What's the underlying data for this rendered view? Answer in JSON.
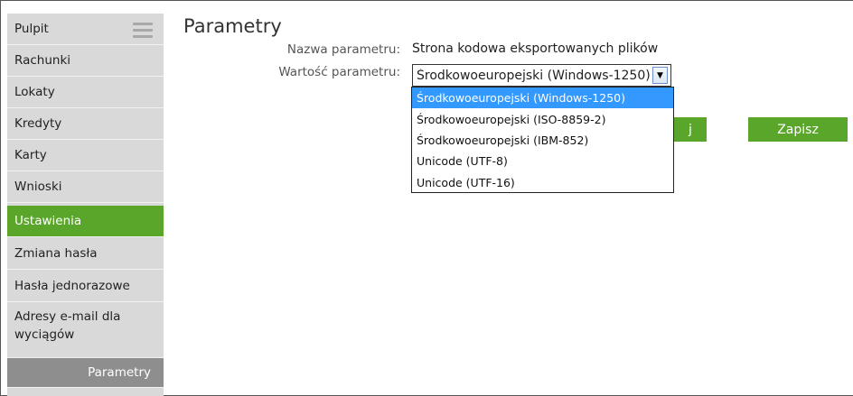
{
  "sidebar": {
    "items": [
      {
        "label": "Pulpit"
      },
      {
        "label": "Rachunki"
      },
      {
        "label": "Lokaty"
      },
      {
        "label": "Kredyty"
      },
      {
        "label": "Karty"
      },
      {
        "label": "Wnioski"
      },
      {
        "label": "Ustawienia"
      },
      {
        "label": "Zmiana hasła"
      },
      {
        "label": "Hasła jednorazowe"
      },
      {
        "label": "Adresy e-mail dla wyciągów"
      },
      {
        "label": "Parametry"
      }
    ],
    "active_item": "Ustawienia",
    "active_subitem": "Parametry"
  },
  "main": {
    "title": "Parametry",
    "param_name_label": "Nazwa parametru:",
    "param_name_value": "Strona kodowa eksportowanych plików",
    "param_value_label": "Wartość parametru:",
    "param_value_selected": "Środkowoeuropejski (Windows-1250)",
    "options": [
      {
        "label": "Środkowoeuropejski (Windows-1250)"
      },
      {
        "label": "Środkowoeuropejski (ISO-8859-2)"
      },
      {
        "label": "Środkowoeuropejski (IBM-852)"
      },
      {
        "label": "Unicode (UTF-8)"
      },
      {
        "label": "Unicode (UTF-16)"
      }
    ],
    "hidden_button_label": "j",
    "save_button_label": "Zapisz"
  },
  "colors": {
    "accent": "#5aa62a",
    "sidebar_bg": "#d9d9d9",
    "sub_item_bg": "#8e8e8e",
    "dropdown_highlight": "#3399ff"
  }
}
